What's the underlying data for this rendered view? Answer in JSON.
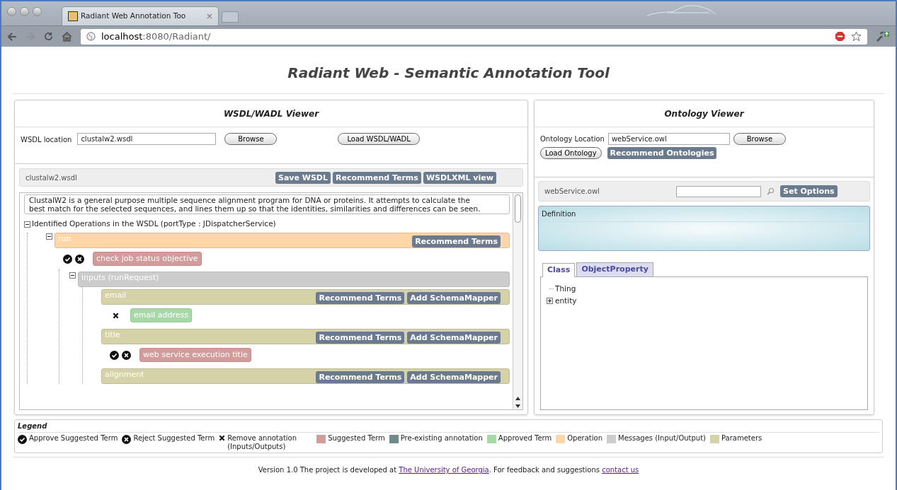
{
  "browser": {
    "tab_title": "Radiant Web Annotation Too",
    "url_host": "localhost",
    "url_path": ":8080/Radiant/"
  },
  "page_title": "Radiant Web - Semantic Annotation Tool",
  "wsdl_viewer": {
    "title": "WSDL/WADL Viewer",
    "location_label": "WSDL location",
    "location_value": "clustalw2.wsdl",
    "browse_button": "Browse",
    "load_button": "Load WSDL/WADL",
    "file_name": "clustalw2.wsdl",
    "toolbar_buttons": [
      "Save WSDL",
      "Recommend Terms",
      "WSDLXML view"
    ],
    "description": "ClustalW2 is a general purpose multiple sequence alignment program for DNA or proteins. It attempts to calculate the best match for the selected sequences, and lines them up so that the identities, similarities and differences can be seen.",
    "tree": {
      "label": "Identified Operations in the WSDL (portType : JDispatcherService)",
      "expanded": true,
      "children": [
        {
          "kind": "operation",
          "label": "run",
          "expanded": true,
          "buttons": [
            "Recommend Terms"
          ],
          "annotations": [
            {
              "kind": "suggested",
              "text": "check job status objective"
            }
          ],
          "children": [
            {
              "kind": "message",
              "label": "inputs (runRequest)",
              "expanded": true,
              "children": [
                {
                  "kind": "parameter",
                  "label": "email",
                  "buttons": [
                    "Recommend Terms",
                    "Add SchemaMapper"
                  ],
                  "annotations": [
                    {
                      "kind": "approved",
                      "text": "email address"
                    }
                  ]
                },
                {
                  "kind": "parameter",
                  "label": "title",
                  "buttons": [
                    "Recommend Terms",
                    "Add SchemaMapper"
                  ],
                  "annotations": [
                    {
                      "kind": "suggested",
                      "text": "web service execution title"
                    }
                  ]
                },
                {
                  "kind": "parameter",
                  "label": "alignment",
                  "buttons": [
                    "Recommend Terms",
                    "Add SchemaMapper"
                  ]
                }
              ]
            }
          ]
        }
      ]
    }
  },
  "ontology_viewer": {
    "title": "Ontology Viewer",
    "location_label": "Ontology Location",
    "location_value": "webService.owl",
    "browse_button": "Browse",
    "load_button": "Load Ontology",
    "recommend_button": "Recommend Ontologies",
    "file_name": "webService.owl",
    "options_button": "Set Options",
    "definition_label": "Definition",
    "tabs": [
      {
        "label": "Class",
        "selected": true
      },
      {
        "label": "ObjectProperty",
        "selected": false
      }
    ],
    "class_tree": [
      {
        "kind": "leaf",
        "label": "Thing"
      },
      {
        "kind": "branch",
        "label": "entity",
        "expanded": false
      }
    ]
  },
  "legend": {
    "title": "Legend",
    "items": [
      {
        "kind": "approve",
        "label": "Approve Suggested Term"
      },
      {
        "kind": "reject",
        "label": "Reject Suggested Term"
      },
      {
        "kind": "remove",
        "label": "Remove annotation (Inputs/Outputs)"
      },
      {
        "kind": "swatch",
        "color": "#d39c9c",
        "label": "Suggested Term"
      },
      {
        "kind": "swatch",
        "color": "#6f8a8c",
        "label": "Pre-existing annotation"
      },
      {
        "kind": "swatch",
        "color": "#a8d8a8",
        "label": "Approved Term"
      },
      {
        "kind": "swatch",
        "color": "#ffd6a8",
        "label": "Operation"
      },
      {
        "kind": "swatch",
        "color": "#cccccc",
        "label": "Messages (Input/Output)"
      },
      {
        "kind": "swatch",
        "color": "#d4d2a6",
        "label": "Parameters"
      }
    ]
  },
  "footer": {
    "parts": [
      {
        "kind": "text",
        "text": "Version 1.0 The project is developed at "
      },
      {
        "kind": "link",
        "text": "The University of Georgia"
      },
      {
        "kind": "text",
        "text": ". For feedback and suggestions "
      },
      {
        "kind": "link",
        "text": "contact us"
      }
    ]
  }
}
